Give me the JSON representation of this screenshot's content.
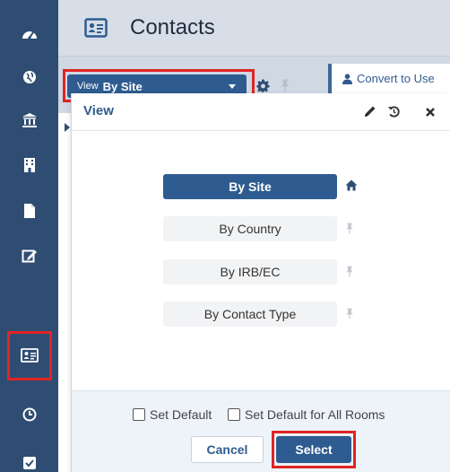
{
  "header": {
    "title": "Contacts"
  },
  "toolbar": {
    "view_label": "View",
    "view_value": "By Site",
    "convert_label": "Convert to Use"
  },
  "modal": {
    "title": "View",
    "options": [
      {
        "label": "By Site",
        "active": true
      },
      {
        "label": "By Country",
        "active": false
      },
      {
        "label": "By IRB/EC",
        "active": false
      },
      {
        "label": "By Contact Type",
        "active": false
      }
    ],
    "set_default_label": "Set Default",
    "set_default_all_label": "Set Default for All Rooms",
    "cancel_label": "Cancel",
    "select_label": "Select"
  },
  "icons": {
    "rail": [
      "dashboard-icon",
      "globe-icon",
      "institution-icon",
      "building-icon",
      "document-icon",
      "edit-icon",
      "contact-card-icon",
      "clock-icon",
      "checkbox-icon"
    ],
    "home_pin": "home-icon",
    "pin": "pin-icon"
  },
  "colors": {
    "rail_bg": "#2f4d73",
    "accent": "#2f5c90",
    "highlight": "#e02424",
    "header_bg": "#d7dee8"
  }
}
